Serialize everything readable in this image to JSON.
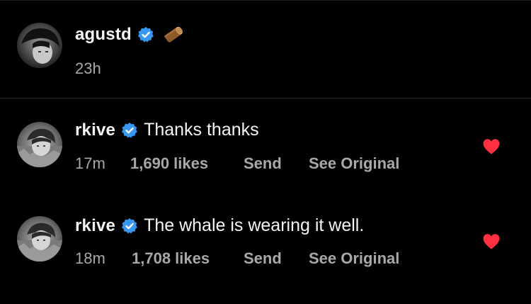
{
  "post": {
    "username": "agustd",
    "caption_emoji": "log-emoji",
    "time": "23h"
  },
  "comments": [
    {
      "username": "rkive",
      "text": "Thanks thanks",
      "time": "17m",
      "likes": "1,690 likes",
      "send": "Send",
      "see_original": "See Original",
      "liked": true
    },
    {
      "username": "rkive",
      "text": "The whale is wearing it well.",
      "time": "18m",
      "likes": "1,708 likes",
      "send": "Send",
      "see_original": "See Original",
      "liked": true
    }
  ],
  "colors": {
    "background": "#000000",
    "primary_text": "#f5f5f5",
    "secondary_text": "#a8a8a8",
    "verified_blue": "#3897f0",
    "heart_red": "#ff3040",
    "divider": "#262626"
  }
}
